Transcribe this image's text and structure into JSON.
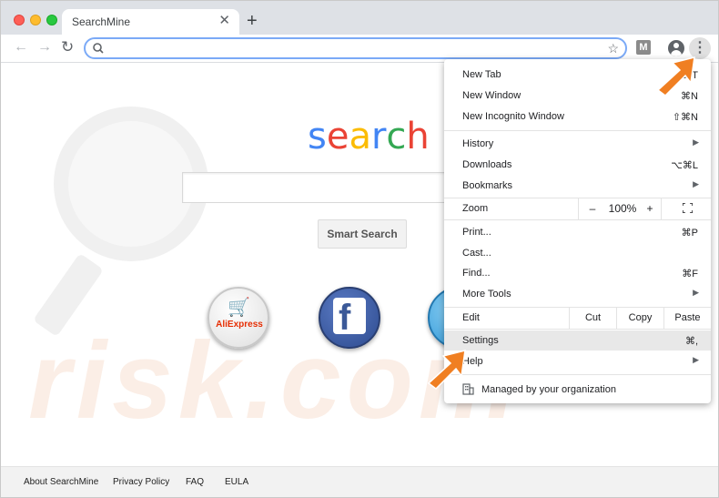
{
  "browser": {
    "tab_title": "SearchMine",
    "tab_close_glyph": "✕",
    "new_tab_glyph": "+",
    "ext_label": "M",
    "menu_glyph": "⋮"
  },
  "page": {
    "logo_letters": [
      {
        "ch": "s",
        "color": "#4285f4"
      },
      {
        "ch": "e",
        "color": "#ea4335"
      },
      {
        "ch": "a",
        "color": "#fbbc05"
      },
      {
        "ch": "r",
        "color": "#4285f4"
      },
      {
        "ch": "c",
        "color": "#34a853"
      },
      {
        "ch": "h",
        "color": "#ea4335"
      }
    ],
    "search_button": "Smart Search",
    "shortcut_ali_label": "AliExpress",
    "shortcut_fb_label": "f",
    "footer_links": [
      "About SearchMine",
      "Privacy Policy",
      "FAQ",
      "EULA"
    ]
  },
  "menu": {
    "new_tab": {
      "label": "New Tab",
      "shortcut": "⌘T"
    },
    "new_window": {
      "label": "New Window",
      "shortcut": "⌘N"
    },
    "new_incognito": {
      "label": "New Incognito Window",
      "shortcut": "⇧⌘N"
    },
    "history": {
      "label": "History"
    },
    "downloads": {
      "label": "Downloads",
      "shortcut": "⌥⌘L"
    },
    "bookmarks": {
      "label": "Bookmarks"
    },
    "zoom": {
      "label": "Zoom",
      "minus": "–",
      "value": "100%",
      "plus": "+"
    },
    "print": {
      "label": "Print...",
      "shortcut": "⌘P"
    },
    "cast": {
      "label": "Cast..."
    },
    "find": {
      "label": "Find...",
      "shortcut": "⌘F"
    },
    "more_tools": {
      "label": "More Tools"
    },
    "edit": {
      "label": "Edit",
      "cut": "Cut",
      "copy": "Copy",
      "paste": "Paste"
    },
    "settings": {
      "label": "Settings",
      "shortcut": "⌘,"
    },
    "help": {
      "label": "Help"
    },
    "managed": {
      "label": "Managed by your organization"
    },
    "submenu_arrow": "▶"
  },
  "watermark": "risk.com",
  "colors": {
    "annotation_arrow": "#f07f22",
    "omnibox_focus": "#7baaf7"
  }
}
